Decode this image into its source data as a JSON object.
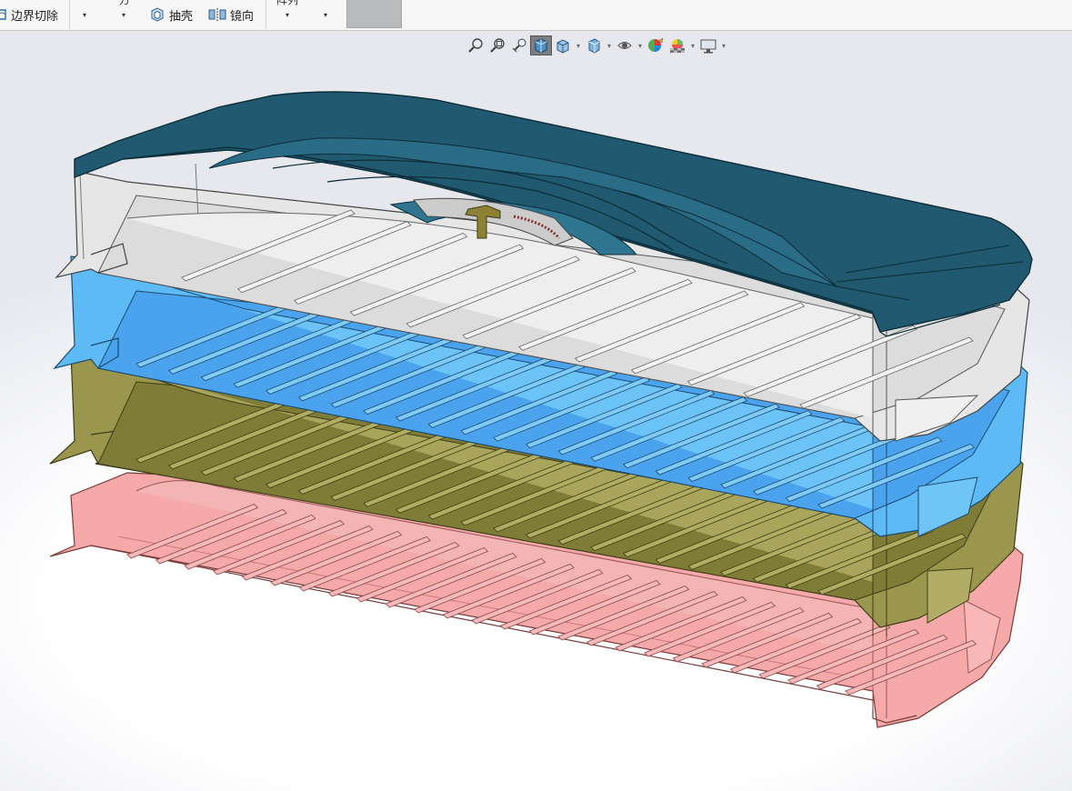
{
  "ribbon": {
    "boundary_cut_label": "边界切除",
    "shell_label": "抽壳",
    "mirror_label": "镜向",
    "partial_top_label_1": "方",
    "partial_top_label_2": "阵列",
    "dropdown_glyph": "▾"
  },
  "heads_up_toolbar": {
    "icons": [
      "zoom-to-fit-icon",
      "zoom-to-area-icon",
      "previous-view-icon",
      "section-view-icon",
      "view-orientation-icon",
      "display-style-icon",
      "hide-show-items-icon",
      "edit-appearance-icon",
      "apply-scene-icon",
      "view-settings-icon"
    ],
    "active_icon": "section-view-icon"
  },
  "model": {
    "description_colors": {
      "lid": "#1f5468",
      "tray_white": "#e4e4e4",
      "tray_blue": "#5ab2f2",
      "tray_olive": "#8f8c48",
      "tray_pink": "#f4a2a2"
    }
  }
}
